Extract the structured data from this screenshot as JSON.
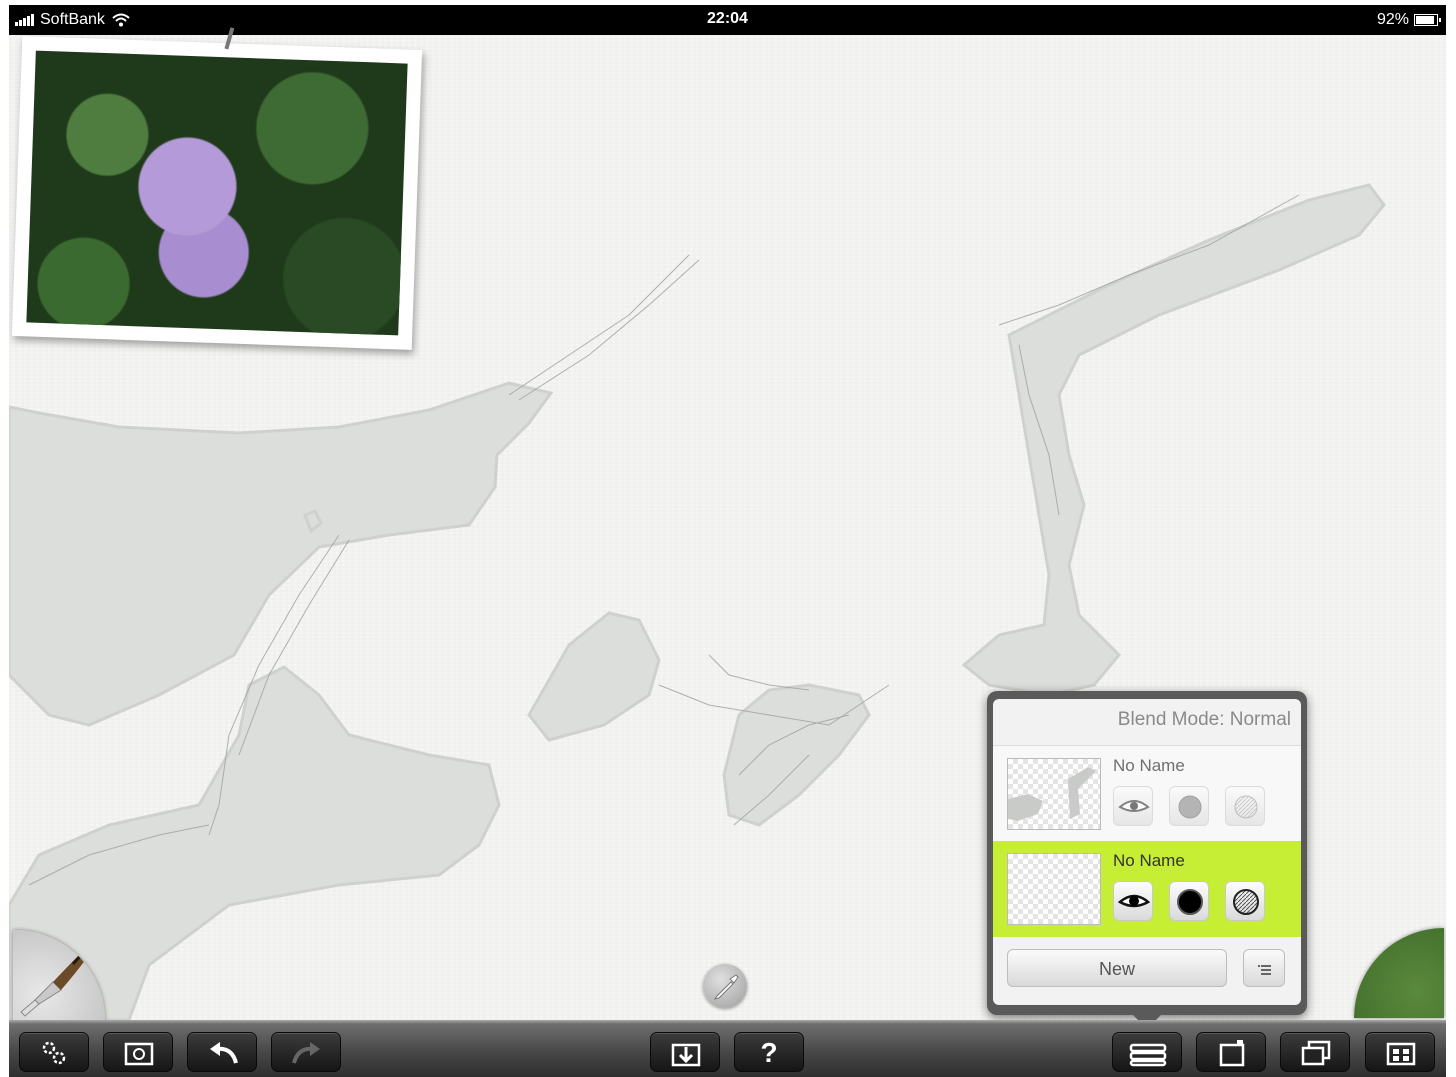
{
  "status_bar": {
    "carrier": "SoftBank",
    "time": "22:04",
    "battery": "92%",
    "battery_level": 0.92
  },
  "layers_panel": {
    "blend_mode": "Blend Mode: Normal",
    "layers": [
      {
        "name": "No Name",
        "selected": false
      },
      {
        "name": "No Name",
        "selected": true
      }
    ],
    "new_label": "New"
  },
  "toolbar": {
    "help_label": "?"
  },
  "colors": {
    "selected_layer": "#c6ee35",
    "current_color": "#3f6a2a",
    "paint": "#dcdedb"
  },
  "icons": [
    "gear-icon",
    "gallery-settings-icon",
    "undo-icon",
    "redo-icon",
    "import-icon",
    "help-icon",
    "layers-icon",
    "new-canvas-icon",
    "duplicate-icon",
    "gallery-icon",
    "brush-icon",
    "eyedropper-icon",
    "eye-icon",
    "alpha-lock-icon",
    "clipping-icon",
    "menu-icon"
  ]
}
